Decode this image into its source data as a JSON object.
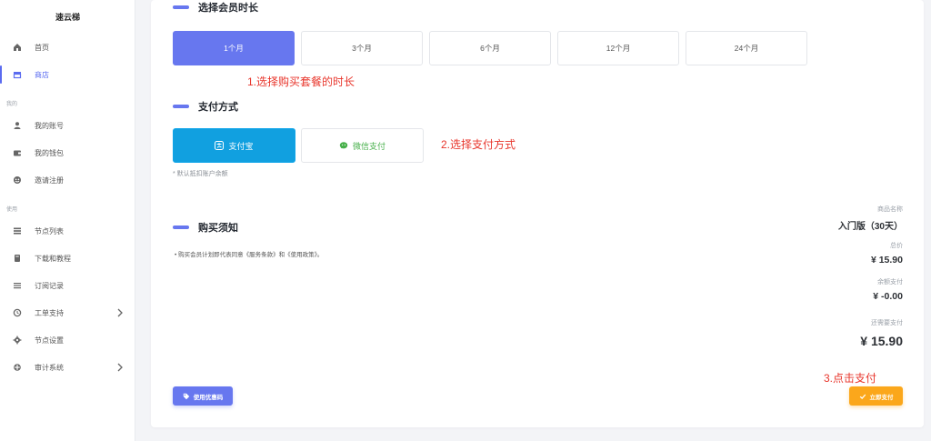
{
  "sidebar": {
    "brand": "速云梯",
    "items": [
      {
        "label": "首页",
        "icon": "home-icon"
      },
      {
        "label": "商店",
        "icon": "store-icon"
      },
      {
        "label": "我的账号",
        "icon": "user-icon"
      },
      {
        "label": "我的钱包",
        "icon": "wallet-icon"
      },
      {
        "label": "邀请注册",
        "icon": "invite-icon"
      },
      {
        "label": "节点列表",
        "icon": "list-icon"
      },
      {
        "label": "下载和教程",
        "icon": "download-icon"
      },
      {
        "label": "订阅记录",
        "icon": "records-icon"
      },
      {
        "label": "工单支持",
        "icon": "support-icon"
      },
      {
        "label": "节点设置",
        "icon": "gear-icon"
      },
      {
        "label": "审计系统",
        "icon": "audit-icon"
      }
    ],
    "section_mine": "我的",
    "section_use": "使用"
  },
  "plan": {
    "duration_title": "选择会员时长",
    "durations": [
      "1个月",
      "3个月",
      "6个月",
      "12个月",
      "24个月"
    ],
    "selected_duration": "1个月",
    "payment_title": "支付方式",
    "payments": [
      "支付宝",
      "微信支付"
    ],
    "selected_payment": "支付宝",
    "payment_hint": "* 默认抵扣账户余额",
    "notice_title": "购买须知",
    "notice_text": "• 购买会员计划即代表同意《服务条款》和《使用政策》。"
  },
  "annotations": {
    "step1": "1.选择购买套餐的时长",
    "step2": "2.选择支付方式",
    "step3": "3.点击支付"
  },
  "summary": {
    "product_label": "商品名称",
    "product_value": "入门版（30天）",
    "total_label": "总价",
    "total_value": "¥ 15.90",
    "balance_label": "余额支付",
    "balance_value": "¥ -0.00",
    "due_label": "还需要支付",
    "due_value": "¥ 15.90"
  },
  "buttons": {
    "coupon": "使用优惠码",
    "pay_now": "立即支付"
  },
  "colors": {
    "primary": "#6777ef",
    "alipay": "#11a0e0",
    "wechat": "#47b04b",
    "pay_now": "#fba71b",
    "annotation": "#e8352b"
  }
}
